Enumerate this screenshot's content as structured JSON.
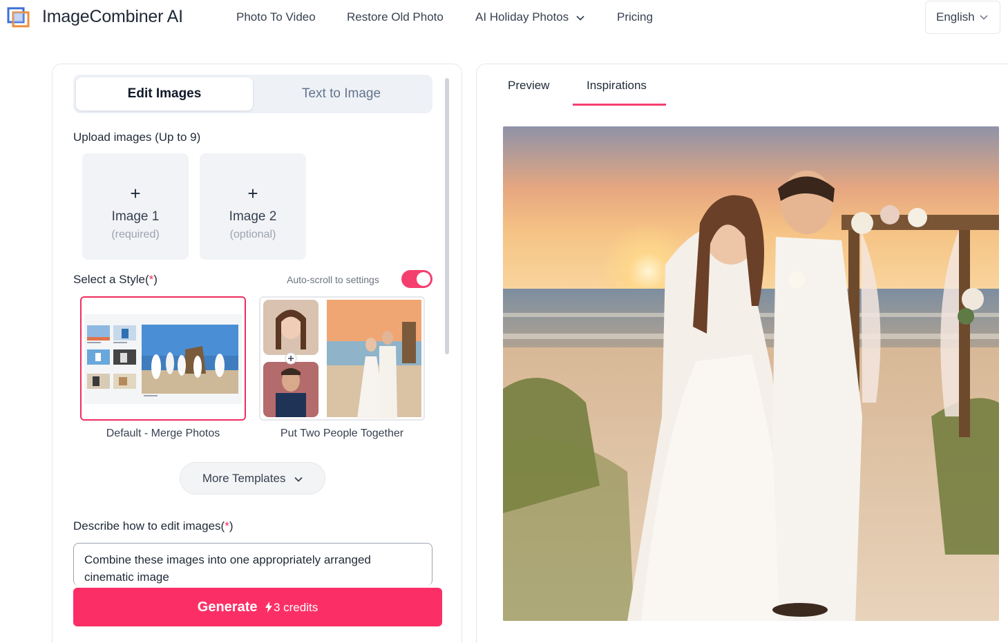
{
  "app": {
    "name": "ImageCombiner AI"
  },
  "nav": {
    "items": [
      {
        "label": "Photo To Video"
      },
      {
        "label": "Restore Old Photo"
      },
      {
        "label": "AI Holiday Photos",
        "has_dropdown": true
      },
      {
        "label": "Pricing"
      }
    ],
    "language": "English"
  },
  "editor": {
    "tabs": [
      {
        "label": "Edit Images",
        "active": true
      },
      {
        "label": "Text to Image",
        "active": false
      }
    ],
    "upload_label": "Upload images (Up to 9)",
    "uploads": [
      {
        "plus": "+",
        "title": "Image 1",
        "note": "(required)"
      },
      {
        "plus": "+",
        "title": "Image 2",
        "note": "(optional)"
      }
    ],
    "style_label": "Select a Style(",
    "style_label_star": "*",
    "style_label_close": ")",
    "autoscroll_label": "Auto-scroll to settings",
    "autoscroll_enabled": true,
    "styles": [
      {
        "caption": "Default - Merge Photos",
        "selected": true
      },
      {
        "caption": "Put Two People Together",
        "selected": false
      }
    ],
    "more_templates": "More Templates",
    "describe_label": "Describe how to edit images(",
    "describe_label_star": "*",
    "describe_label_close": ")",
    "prompt_value": "Combine these images into one appropriately arranged cinematic image",
    "generate": {
      "label": "Generate",
      "credits": "3 credits"
    }
  },
  "viewer": {
    "tabs": [
      {
        "label": "Preview",
        "active": false
      },
      {
        "label": "Inspirations",
        "active": true
      }
    ]
  },
  "colors": {
    "accent": "#fb2f66",
    "toggle": "#f43f6e",
    "text": "#1f2937"
  }
}
